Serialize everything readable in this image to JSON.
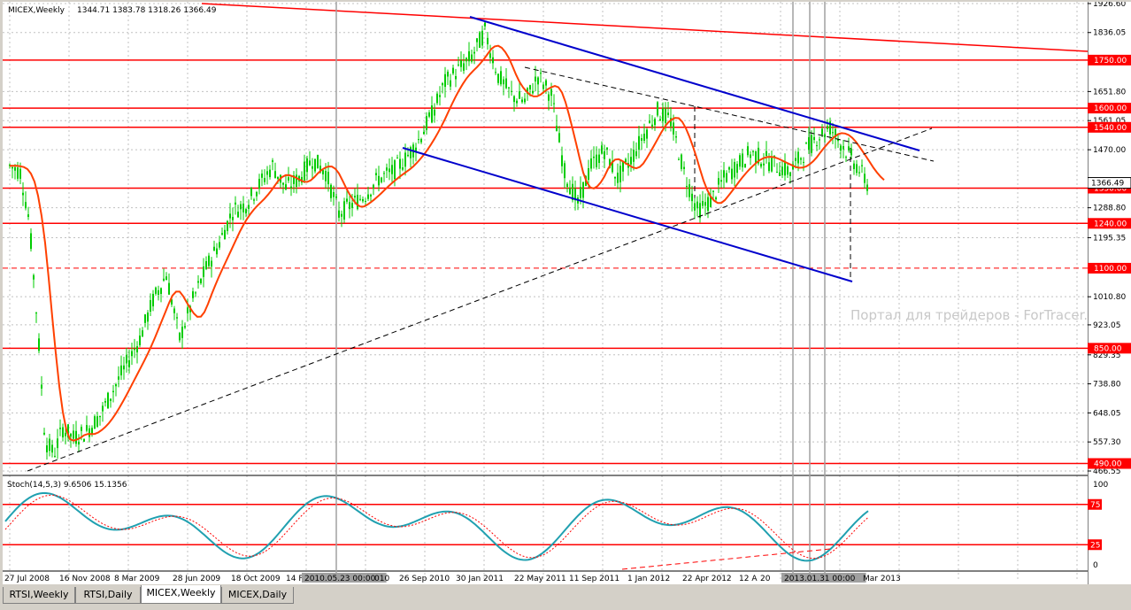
{
  "chart": {
    "symbol_info": "MICEX,Weekly",
    "ohlc": "1344.71 1383.78 1318.26 1366.49",
    "stoch_info": "Stoch(14,5,3) 9.6506 15.1356",
    "watermark": "Портал для трейдеров - ForTracer.ru",
    "time_axis": [
      "27 Jul 2008",
      "16 Nov 2008",
      "8 Mar 2009",
      "28 Jun 2009",
      "18 Oct 2009",
      "14 F",
      "2010.05.23 00:00",
      "010",
      "26 Sep 2010",
      "30 Jan 2011",
      "22 May 2011",
      "11 Sep 2011",
      "1 Jan 2012",
      "22 Apr 2012",
      "12 A",
      "20",
      "2013.01.31 00:00",
      "Mar 2013"
    ],
    "price_axis": [
      "1926.60",
      "1836.05",
      "1651.80",
      "1561.05",
      "1470.00",
      "1288.80",
      "1195.35",
      "1010.80",
      "923.05",
      "829.35",
      "738.80",
      "648.05",
      "557.30",
      "466.55"
    ],
    "level_tags": [
      "1750.00",
      "1600.00",
      "1540.00",
      "1350.00",
      "1240.00",
      "1100.00",
      "850.00",
      "490.00"
    ],
    "current_price": "1366.49",
    "stoch_axis": [
      "100",
      "75",
      "25",
      "0"
    ],
    "colors": {
      "level": "#ff0000",
      "channel": "#0000cc",
      "ma": "#ff4000",
      "bull": "#00cc00",
      "stoch_main": "#20a0b0",
      "stoch_signal": "#ff0000"
    }
  },
  "tabs": [
    {
      "label": "RTSI,Weekly"
    },
    {
      "label": "RTSI,Daily"
    },
    {
      "label": "MICEX,Weekly",
      "active": true
    },
    {
      "label": "MICEX,Daily"
    }
  ]
}
